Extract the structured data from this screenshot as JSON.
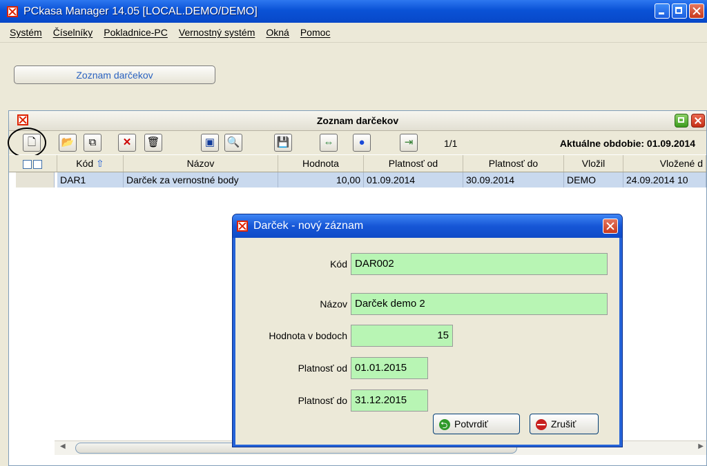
{
  "app": {
    "title": "PCkasa Manager 14.05 [LOCAL.DEMO/DEMO]"
  },
  "menu": {
    "items": [
      "Systém",
      "Číselníky",
      "Pokladnice-PC",
      "Vernostný systém",
      "Okná",
      "Pomoc"
    ]
  },
  "tabs": {
    "open_window_label": "Zoznam darčekov"
  },
  "inner": {
    "title": "Zoznam darčekov",
    "page_info": "1/1",
    "period": "Aktuálne obdobie: 01.09.2014"
  },
  "toolbar": {
    "icons": [
      "new-document-icon",
      "open-folder-icon",
      "copy-icon",
      "delete-icon",
      "recycle-bin-icon",
      "monitor-icon",
      "print-preview-icon",
      "save-icon",
      "export-icon",
      "dot-icon",
      "exit-icon"
    ]
  },
  "grid": {
    "columns": [
      "Kód",
      "Názov",
      "Hodnota",
      "Platnosť od",
      "Platnosť do",
      "Vložil",
      "Vložené d"
    ],
    "rows": [
      [
        "DAR1",
        "Darček za vernostné body",
        "10,00",
        "01.09.2014",
        "30.09.2014",
        "DEMO",
        "24.09.2014 10"
      ]
    ]
  },
  "dialog": {
    "title": "Darček - nový záznam",
    "fields": {
      "kod_label": "Kód",
      "kod_value": "DAR002",
      "nazov_label": "Názov",
      "nazov_value": "Darček demo 2",
      "hodnota_label": "Hodnota v bodoch",
      "hodnota_value": "15",
      "od_label": "Platnosť od",
      "od_value": "01.01.2015",
      "do_label": "Platnosť do",
      "do_value": "31.12.2015"
    },
    "confirm_label": "Potvrdiť",
    "cancel_label": "Zrušiť"
  },
  "colors": {
    "title_blue": "#0a52d6",
    "input_green": "#b8f5b4",
    "row_selected": "#c9d9ee"
  }
}
